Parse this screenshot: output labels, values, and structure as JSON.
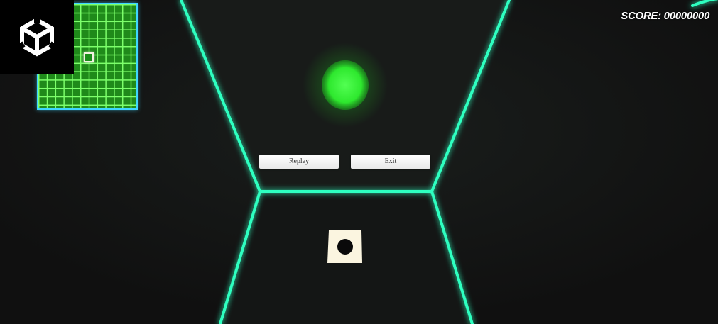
{
  "hud": {
    "score_label": "SCORE: 00000000"
  },
  "menu": {
    "replay_label": "Replay",
    "exit_label": "Exit"
  },
  "icons": {
    "logo": "unity-logo-icon",
    "target": "green-orb",
    "player": "player-tile-icon"
  },
  "colors": {
    "neon": "#2effc0",
    "orb": "#3aff3a",
    "minimap_grid": "#7dff6b",
    "minimap_border": "#3fd6ff"
  }
}
